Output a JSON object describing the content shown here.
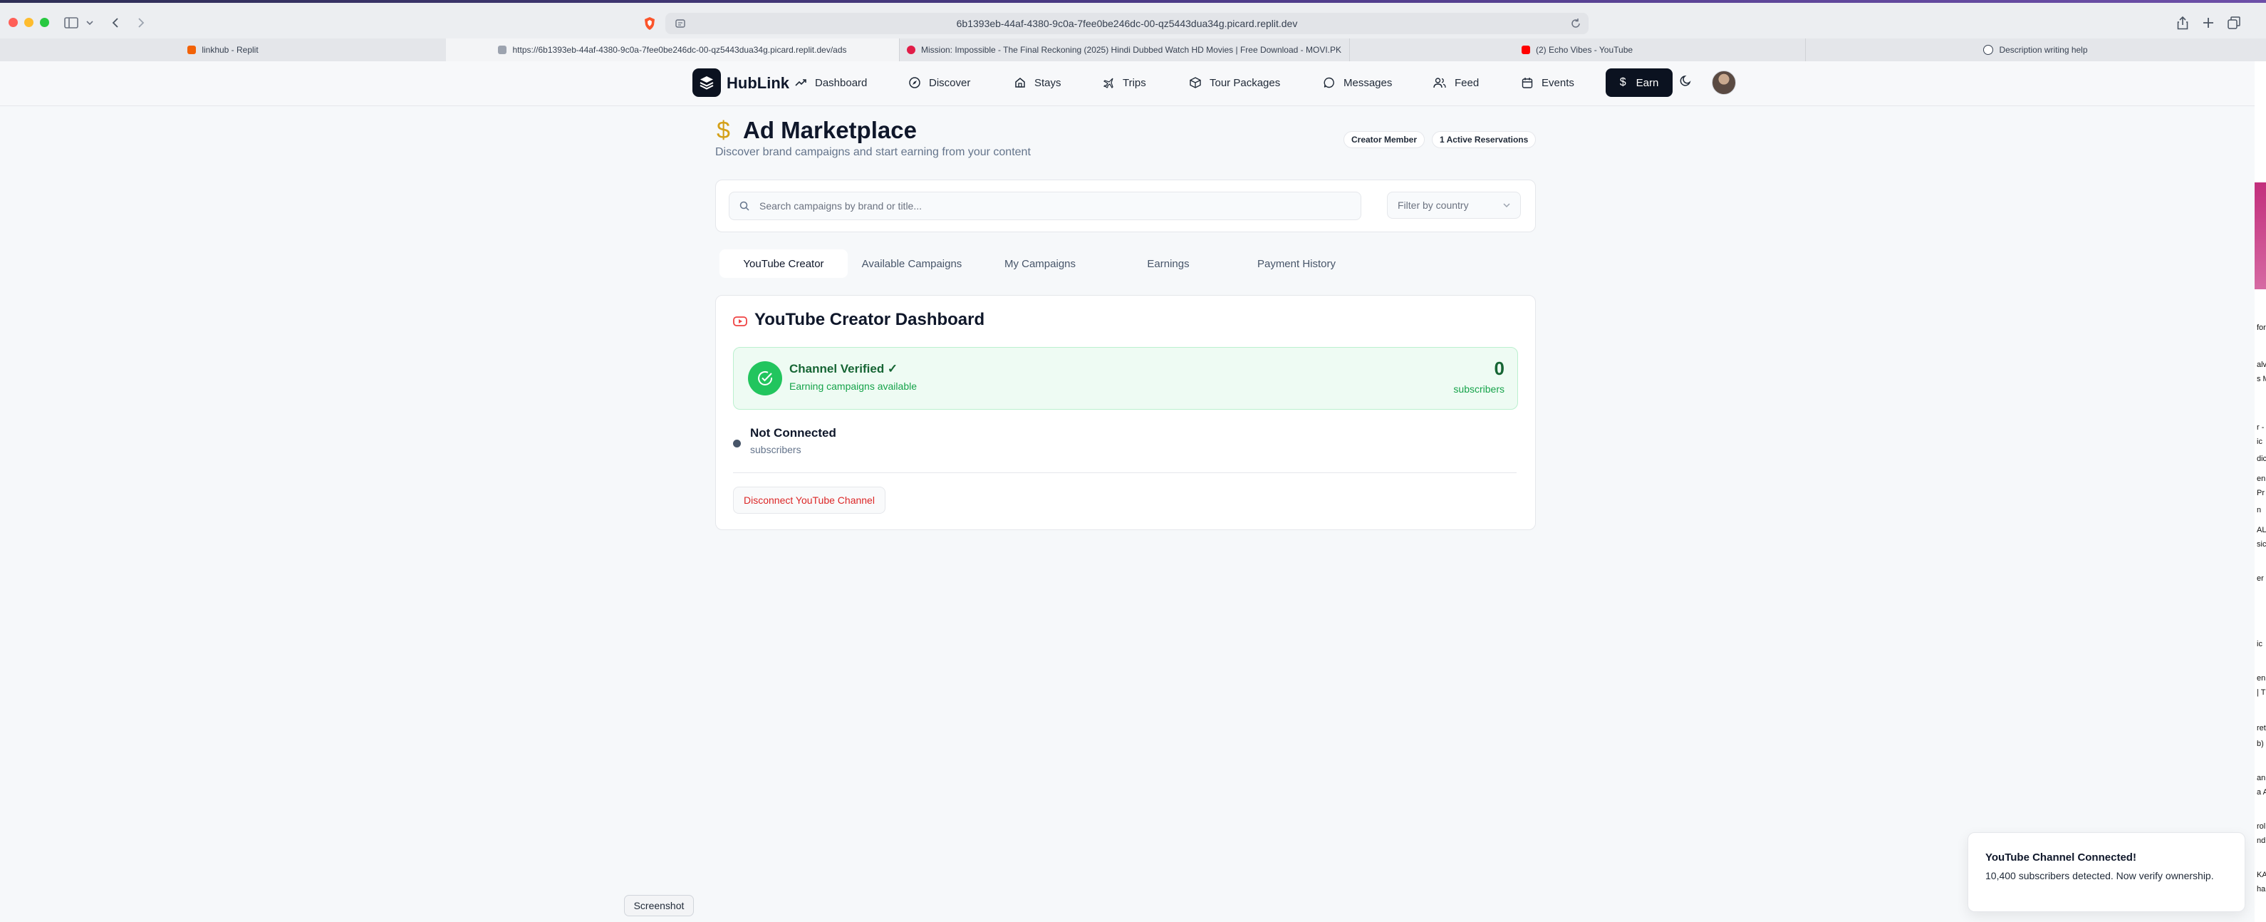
{
  "browser": {
    "address": "6b1393eb-44af-4380-9c0a-7fee0be246dc-00-qz5443dua34g.picard.replit.dev",
    "tabs": [
      {
        "label": "linkhub - Replit",
        "icon": "replit-icon",
        "color": "#f26207"
      },
      {
        "label": "https://6b1393eb-44af-4380-9c0a-7fee0be246dc-00-qz5443dua34g.picard.replit.dev/ads",
        "icon": "page-icon",
        "color": "#6b7280"
      },
      {
        "label": "Mission: Impossible - The Final Reckoning (2025) Hindi Dubbed Watch HD Movies | Free Download - MOVI.PK",
        "icon": "movie-site-icon",
        "color": "#e11d48"
      },
      {
        "label": "(2) Echo Vibes - YouTube",
        "icon": "youtube-icon",
        "color": "#ff0000"
      },
      {
        "label": "Description writing help",
        "icon": "chatgpt-icon",
        "color": "#374151"
      }
    ]
  },
  "side_strip": [
    "for",
    "alv",
    "s M",
    "r -",
    "ic",
    "dic",
    "en",
    "Pr",
    "n",
    "AL",
    "sic",
    "er (",
    "ic",
    "en",
    "| T",
    "ret",
    "b)",
    "an",
    "a A",
    "rol",
    "nd",
    "KA",
    "ha"
  ],
  "nav": {
    "brand": "HubLink",
    "items": [
      {
        "label": "Dashboard",
        "icon": "trending-up-icon"
      },
      {
        "label": "Discover",
        "icon": "compass-icon"
      },
      {
        "label": "Stays",
        "icon": "home-icon"
      },
      {
        "label": "Trips",
        "icon": "plane-icon"
      },
      {
        "label": "Tour Packages",
        "icon": "package-icon"
      },
      {
        "label": "Messages",
        "icon": "message-circle-icon"
      },
      {
        "label": "Feed",
        "icon": "users-icon"
      },
      {
        "label": "Events",
        "icon": "calendar-icon"
      }
    ],
    "earn_label": "Earn"
  },
  "header": {
    "icon": "dollar-icon",
    "title": "Ad Marketplace",
    "subtitle": "Discover brand campaigns and start earning from your content",
    "badges": [
      "Creator Member",
      "1 Active Reservations"
    ]
  },
  "search": {
    "placeholder": "Search campaigns by brand or title...",
    "value": "",
    "country_filter": "Filter by country"
  },
  "tabs": [
    {
      "label": "YouTube Creator",
      "active": true
    },
    {
      "label": "Available Campaigns",
      "active": false
    },
    {
      "label": "My Campaigns",
      "active": false
    },
    {
      "label": "Earnings",
      "active": false
    },
    {
      "label": "Payment History",
      "active": false
    }
  ],
  "dashboard": {
    "title": "YouTube Creator Dashboard",
    "verified_title": "Channel Verified ✓",
    "verified_subtitle": "Earning campaigns available",
    "subscriber_count": "0",
    "subscriber_label": "subscribers",
    "status_title": "Not Connected",
    "status_subtitle": "subscribers",
    "disconnect_label": "Disconnect YouTube Channel"
  },
  "toast": {
    "title": "YouTube Channel Connected!",
    "body": "10,400 subscribers detected. Now verify ownership."
  },
  "screenshot_label": "Screenshot",
  "colors": {
    "brand_dark": "#0b1220",
    "success": "#22c55e",
    "danger": "#dc2626",
    "accent_gold": "#d4a017"
  }
}
